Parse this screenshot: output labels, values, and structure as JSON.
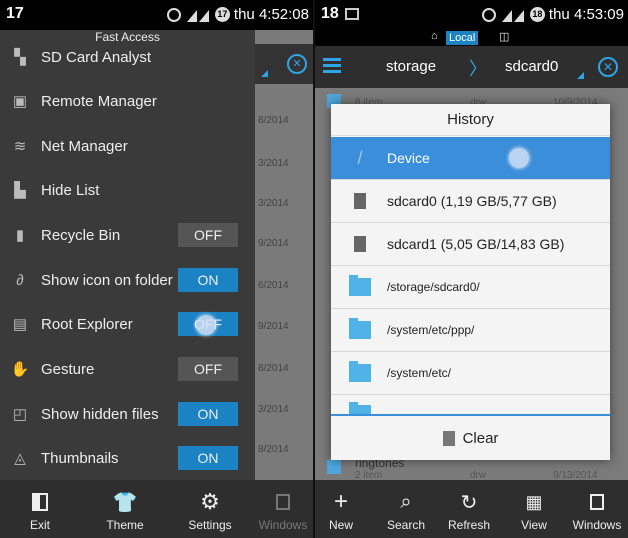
{
  "left": {
    "status": {
      "left_number": "17",
      "badge": "17",
      "time": "thu 4:52:08"
    },
    "drawer_title": "Fast Access",
    "items": [
      {
        "label": "SD Card Analyst",
        "icon": "sd-analyst-icon"
      },
      {
        "label": "Remote Manager",
        "icon": "remote-icon"
      },
      {
        "label": "Net Manager",
        "icon": "wifi-icon"
      },
      {
        "label": "Hide List",
        "icon": "hide-folder-icon"
      },
      {
        "label": "Recycle Bin",
        "icon": "trash-icon",
        "toggle": "OFF"
      },
      {
        "label": "Show icon on folder",
        "icon": "paperclip-icon",
        "toggle": "ON"
      },
      {
        "label": "Root Explorer",
        "icon": "root-icon",
        "toggle": "OFF"
      },
      {
        "label": "Gesture",
        "icon": "gesture-icon",
        "toggle": "OFF"
      },
      {
        "label": "Show hidden files",
        "icon": "hidden-file-icon",
        "toggle": "ON"
      },
      {
        "label": "Thumbnails",
        "icon": "thumbnail-icon",
        "toggle": "ON"
      }
    ],
    "behind_dates": [
      "8/2014",
      "3/2014",
      "3/2014",
      "9/2014",
      "6/2014",
      "9/2014",
      "8/2014",
      "3/2014",
      "8/2014"
    ],
    "bottom": [
      {
        "label": "Exit",
        "icon": "exit-icon"
      },
      {
        "label": "Theme",
        "icon": "shirt-icon"
      },
      {
        "label": "Settings",
        "icon": "gear-icon"
      },
      {
        "label": "Windows",
        "icon": "windows-icon"
      }
    ]
  },
  "right": {
    "status": {
      "left_number": "18",
      "badge": "18",
      "time": "thu 4:53:09"
    },
    "local_label": "Local",
    "crumbs": [
      "storage",
      "sdcard0"
    ],
    "bg_top": {
      "name": "8 item",
      "type": "drw",
      "date": "10/9/2014"
    },
    "bg_bottom": {
      "name": "ringtones",
      "count": "2 item",
      "type": "drw",
      "date": "9/13/2014"
    },
    "dialog": {
      "title": "History",
      "rows": [
        {
          "label": "Device",
          "icon": "slash-icon",
          "selected": true
        },
        {
          "label": "sdcard0 (1,19 GB/5,77 GB)",
          "icon": "sdcard-icon"
        },
        {
          "label": "sdcard1 (5,05 GB/14,83 GB)",
          "icon": "sdcard-icon"
        },
        {
          "label": "/storage/sdcard0/",
          "icon": "folder-icon"
        },
        {
          "label": "/system/etc/ppp/",
          "icon": "folder-icon"
        },
        {
          "label": "/system/etc/",
          "icon": "folder-icon"
        }
      ],
      "clear_label": "Clear"
    },
    "bottom": [
      {
        "label": "New",
        "icon": "plus-icon"
      },
      {
        "label": "Search",
        "icon": "search-icon"
      },
      {
        "label": "Refresh",
        "icon": "refresh-icon"
      },
      {
        "label": "View",
        "icon": "grid-icon"
      },
      {
        "label": "Windows",
        "icon": "windows-icon"
      }
    ]
  },
  "colors": {
    "accent": "#1b82c4",
    "selection": "#3b8ed9",
    "folder": "#4fb3e8"
  }
}
